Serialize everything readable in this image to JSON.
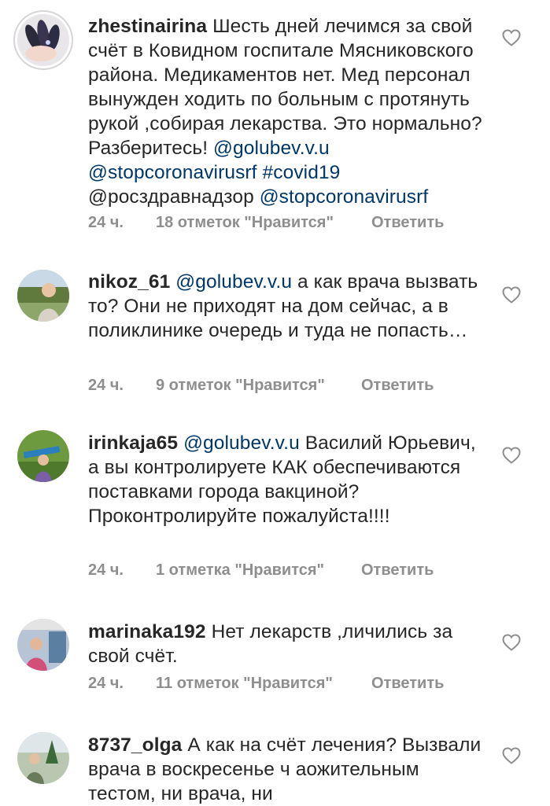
{
  "comments": [
    {
      "username": "zhestinairina",
      "segments": [
        {
          "t": "Шесть дней лечимся за свой счёт в Ковидном госпитале Мясниковского района. Медикаментов нет. Мед персонал вынужден ходить по больным с протянуть рукой ,собирая лекарства. Это нормально? Разберитесь! "
        },
        {
          "t": "@golubev.v.u",
          "link": true
        },
        {
          "t": " "
        },
        {
          "t": "@stopcoronavirusrf",
          "link": true
        },
        {
          "t": " "
        },
        {
          "t": "#covid19",
          "link": true
        },
        {
          "t": " @росздравнадзор "
        },
        {
          "t": "@stopcoronavirusrf",
          "link": true
        }
      ],
      "time": "24 ч.",
      "likes": "18 отметок \"Нравится\"",
      "reply": "Ответить"
    },
    {
      "username": "nikoz_61",
      "segments": [
        {
          "t": "@golubev.v.u",
          "link": true
        },
        {
          "t": " а как врача вызвать то? Они не приходят на дом сейчас, а в поликлинике очередь и туда не попасть…"
        }
      ],
      "time": "24 ч.",
      "likes": "9 отметок \"Нравится\"",
      "reply": "Ответить"
    },
    {
      "username": "irinkaja65",
      "segments": [
        {
          "t": "@golubev.v.u",
          "link": true
        },
        {
          "t": " Василий Юрьевич, а вы контролируете КАК обеспечиваются поставками города вакциной?Проконтролируйте пожалуйста!!!!"
        }
      ],
      "time": "24 ч.",
      "likes": "1 отметка \"Нравится\"",
      "reply": "Ответить"
    },
    {
      "username": "marinaka192",
      "segments": [
        {
          "t": "Нет лекарств ,личились за свой счёт."
        }
      ],
      "time": "24 ч.",
      "likes": "11 отметок \"Нравится\"",
      "reply": "Ответить"
    },
    {
      "username": "8737_olga",
      "segments": [
        {
          "t": "А как на счёт лечения? Вызвали врача в воскресенье ч аожительным тестом, ни врача, ни"
        }
      ],
      "time": "",
      "likes": "",
      "reply": ""
    }
  ],
  "icons": {
    "like": "heart-outline-icon"
  },
  "colors": {
    "text": "#262626",
    "link": "#00376b",
    "meta": "#8e8e8e",
    "heart": "#8e8e8e"
  }
}
